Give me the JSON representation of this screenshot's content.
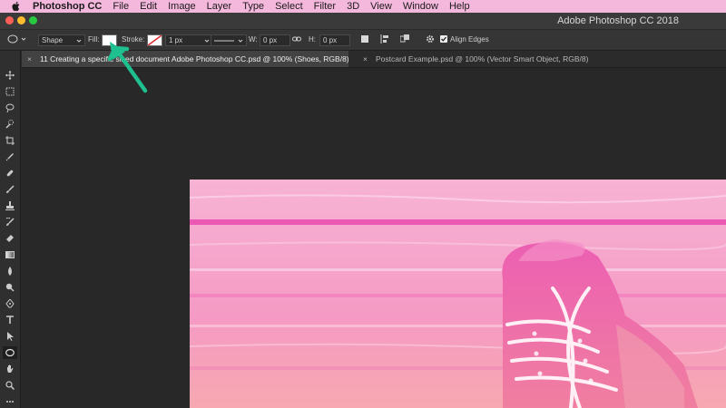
{
  "menubar": {
    "app_name": "Photoshop CC",
    "items": [
      "File",
      "Edit",
      "Image",
      "Layer",
      "Type",
      "Select",
      "Filter",
      "3D",
      "View",
      "Window",
      "Help"
    ]
  },
  "window": {
    "title": "Adobe Photoshop CC 2018"
  },
  "options": {
    "mode": "Shape",
    "fill_label": "Fill:",
    "stroke_label": "Stroke:",
    "stroke_width": "1 px",
    "w_label": "W:",
    "w_value": "0 px",
    "h_label": "H:",
    "h_value": "0 px",
    "align_edges": "Align Edges"
  },
  "tabs": [
    {
      "label": "11 Creating a specific sized document Adobe Photoshop CC.psd @ 100% (Shoes, RGB/8)"
    },
    {
      "label": "Postcard Example.psd @ 100% (Vector Smart Object, RGB/8)"
    }
  ],
  "tabs_close_glyph": "×",
  "colors": {
    "menubar": "#f5b8dd",
    "annotation_arrow": "#1fc08f",
    "image_pink": "#f59ac4"
  },
  "toolbar": {
    "tools": [
      "move-icon",
      "marquee-icon",
      "lasso-icon",
      "quick-select-icon",
      "crop-icon",
      "eyedropper-icon",
      "healing-icon",
      "brush-icon",
      "stamp-icon",
      "history-brush-icon",
      "eraser-icon",
      "gradient-icon",
      "blur-icon",
      "dodge-icon",
      "pen-icon",
      "type-icon",
      "path-select-icon",
      "ellipse-icon",
      "hand-icon",
      "zoom-icon"
    ]
  }
}
